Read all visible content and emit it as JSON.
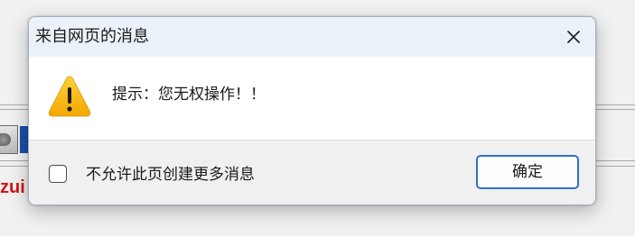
{
  "dialog": {
    "title": "来自网页的消息",
    "message": "提示：您无权操作！！",
    "checkbox_label": "不允许此页创建更多消息",
    "checkbox_checked": false,
    "ok_label": "确定",
    "icons": {
      "close": "close-icon",
      "warning": "warning-icon"
    }
  },
  "background": {
    "partial_text": "zui"
  },
  "colors": {
    "titlebar": "#eaf1f9",
    "warning": "#f7b500",
    "button_border": "#2f72c9",
    "background_text": "#d0161a"
  }
}
